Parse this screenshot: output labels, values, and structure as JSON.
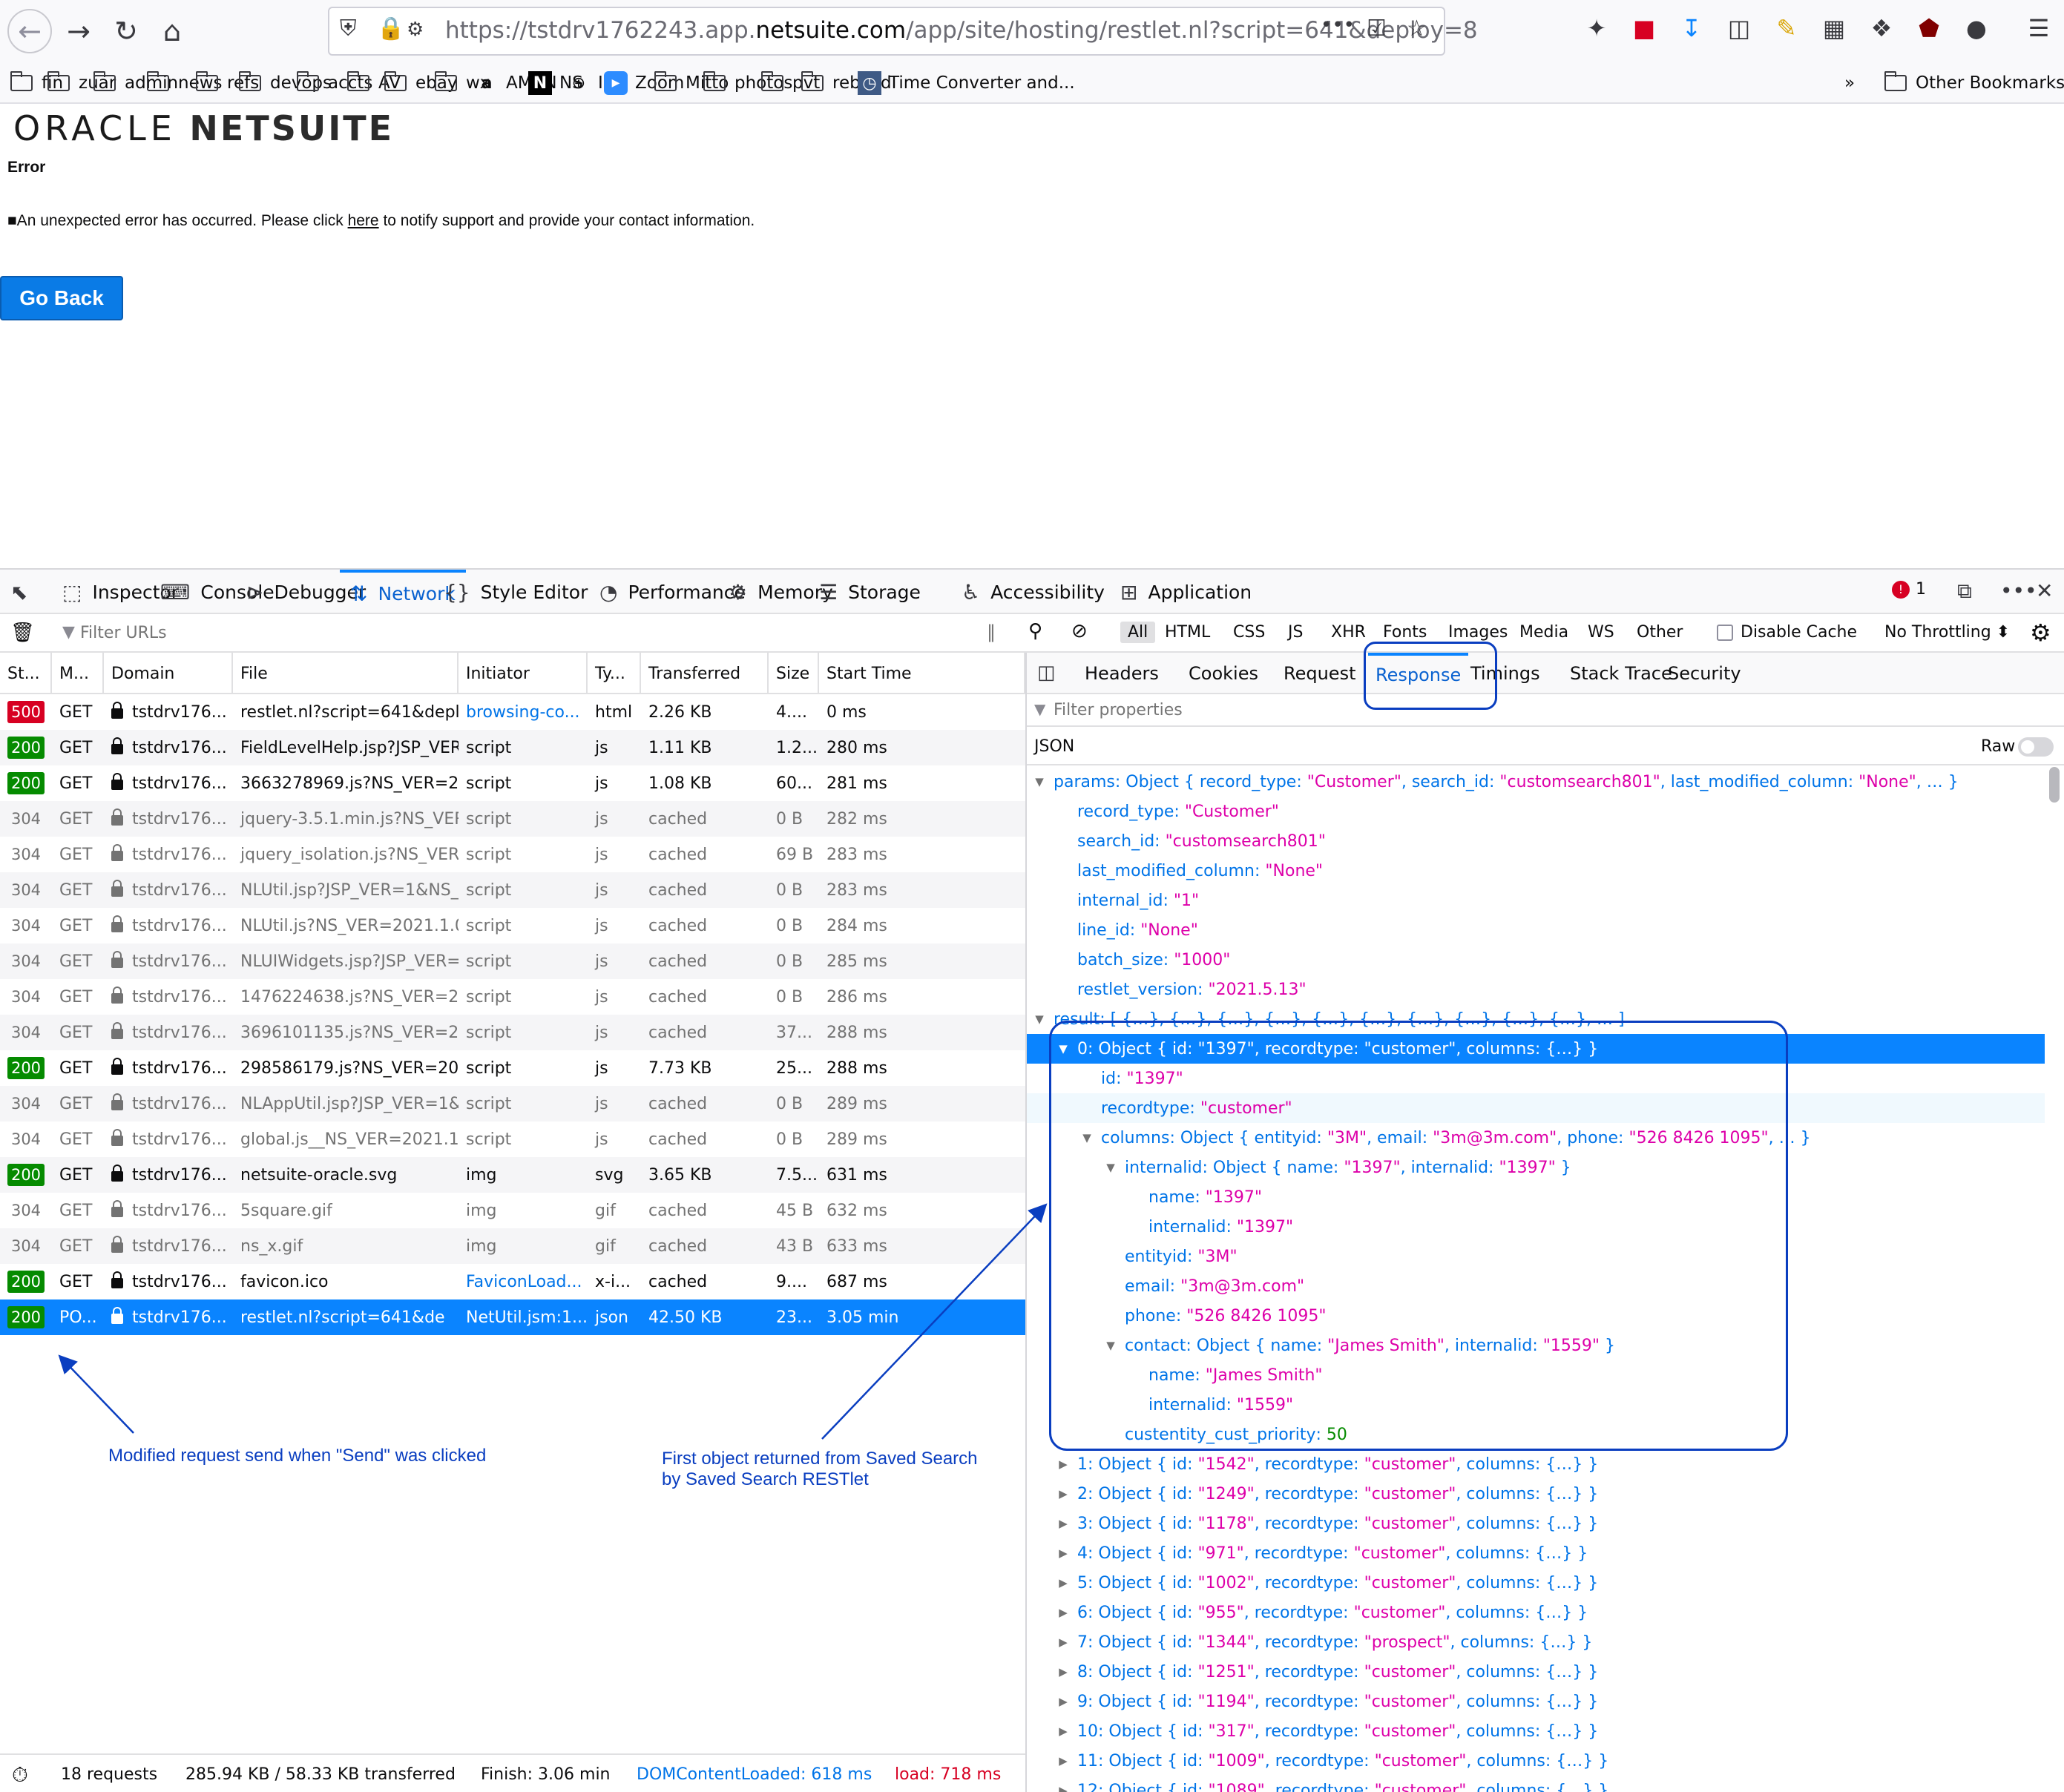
{
  "browser": {
    "url_prefix": "https://tstdrv1762243.app.",
    "url_domain": "netsuite.com",
    "url_suffix": "/app/site/hosting/restlet.nl?script=641&deploy=8",
    "more": "•••"
  },
  "bookmarks": [
    {
      "label": "fin",
      "icon": "folder-icon"
    },
    {
      "label": "zuar",
      "icon": "folder-icon"
    },
    {
      "label": "admin",
      "icon": "folder-icon"
    },
    {
      "label": "news",
      "icon": "folder-icon"
    },
    {
      "label": "refs",
      "icon": "folder-icon"
    },
    {
      "label": "devops",
      "icon": "folder-icon"
    },
    {
      "label": "accts",
      "icon": "folder-icon"
    },
    {
      "label": "AV",
      "icon": "folder-icon"
    },
    {
      "label": "ebay",
      "icon": "folder-icon"
    },
    {
      "label": "wx",
      "icon": "folder-icon"
    },
    {
      "label": "AMZN",
      "icon": "amazon-icon"
    },
    {
      "label": "NS",
      "icon": "netsuite-icon"
    },
    {
      "label": "IP",
      "icon": "globe-icon"
    },
    {
      "label": "Zoom",
      "icon": "zoom-icon"
    },
    {
      "label": "Mitto",
      "icon": "folder-icon"
    },
    {
      "label": "photos",
      "icon": "folder-icon"
    },
    {
      "label": "pvt",
      "icon": "folder-icon"
    },
    {
      "label": "rebuild",
      "icon": "folder-icon"
    },
    {
      "label": "Time Converter and...",
      "icon": "clock-icon"
    }
  ],
  "other_bookmarks": "Other Bookmarks",
  "page": {
    "logo_oracle": "ORACLE",
    "logo_netsuite": "NETSUITE",
    "error_title": "Error",
    "error_prefix": "■An unexpected error has occurred. Please click ",
    "error_link": "here",
    "error_suffix": " to notify support and provide your contact information.",
    "go_back": "Go Back"
  },
  "devtools": {
    "tabs": [
      "Inspector",
      "Console",
      "Debugger",
      "Network",
      "Style Editor",
      "Performance",
      "Memory",
      "Storage",
      "Accessibility",
      "Application"
    ],
    "selected_tab": "Network",
    "error_count": "1",
    "filter_placeholder": "Filter URLs",
    "type_filters": [
      "All",
      "HTML",
      "CSS",
      "JS",
      "XHR",
      "Fonts",
      "Images",
      "Media",
      "WS",
      "Other"
    ],
    "disable_cache": "Disable Cache",
    "throttling": "No Throttling ⬍",
    "columns": [
      "St...",
      "M...",
      "Domain",
      "File",
      "Initiator",
      "Ty...",
      "Transferred",
      "Size",
      "Start Time"
    ],
    "requests": [
      {
        "status": "500",
        "method": "GET",
        "domain": "tstdrv176...",
        "file": "restlet.nl?script=641&deploy",
        "initiator": "browsing-co...",
        "type": "html",
        "transferred": "2.26 KB",
        "size": "4....",
        "start": "0 ms"
      },
      {
        "status": "200",
        "method": "GET",
        "domain": "tstdrv176...",
        "file": "FieldLevelHelp.jsp?JSP_VER",
        "initiator": "script",
        "type": "js",
        "transferred": "1.11 KB",
        "size": "1.2...",
        "start": "280 ms"
      },
      {
        "status": "200",
        "method": "GET",
        "domain": "tstdrv176...",
        "file": "3663278969.js?NS_VER=20",
        "initiator": "script",
        "type": "js",
        "transferred": "1.08 KB",
        "size": "60...",
        "start": "281 ms"
      },
      {
        "status": "304",
        "method": "GET",
        "domain": "tstdrv176...",
        "file": "jquery-3.5.1.min.js?NS_VER=",
        "initiator": "script",
        "type": "js",
        "transferred": "cached",
        "size": "0 B",
        "start": "282 ms"
      },
      {
        "status": "304",
        "method": "GET",
        "domain": "tstdrv176...",
        "file": "jquery_isolation.js?NS_VER=",
        "initiator": "script",
        "type": "js",
        "transferred": "cached",
        "size": "69 B",
        "start": "283 ms"
      },
      {
        "status": "304",
        "method": "GET",
        "domain": "tstdrv176...",
        "file": "NLUtil.jsp?JSP_VER=1&NS_V",
        "initiator": "script",
        "type": "js",
        "transferred": "cached",
        "size": "0 B",
        "start": "283 ms"
      },
      {
        "status": "304",
        "method": "GET",
        "domain": "tstdrv176...",
        "file": "NLUtil.js?NS_VER=2021.1.08",
        "initiator": "script",
        "type": "js",
        "transferred": "cached",
        "size": "0 B",
        "start": "284 ms"
      },
      {
        "status": "304",
        "method": "GET",
        "domain": "tstdrv176...",
        "file": "NLUIWidgets.jsp?JSP_VER=1",
        "initiator": "script",
        "type": "js",
        "transferred": "cached",
        "size": "0 B",
        "start": "285 ms"
      },
      {
        "status": "304",
        "method": "GET",
        "domain": "tstdrv176...",
        "file": "1476224638.js?NS_VER=20",
        "initiator": "script",
        "type": "js",
        "transferred": "cached",
        "size": "0 B",
        "start": "286 ms"
      },
      {
        "status": "304",
        "method": "GET",
        "domain": "tstdrv176...",
        "file": "3696101135.js?NS_VER=202",
        "initiator": "script",
        "type": "js",
        "transferred": "cached",
        "size": "37...",
        "start": "288 ms"
      },
      {
        "status": "200",
        "method": "GET",
        "domain": "tstdrv176...",
        "file": "298586179.js?NS_VER=202",
        "initiator": "script",
        "type": "js",
        "transferred": "7.73 KB",
        "size": "25...",
        "start": "288 ms"
      },
      {
        "status": "304",
        "method": "GET",
        "domain": "tstdrv176...",
        "file": "NLAppUtil.jsp?JSP_VER=1&N",
        "initiator": "script",
        "type": "js",
        "transferred": "cached",
        "size": "0 B",
        "start": "289 ms"
      },
      {
        "status": "304",
        "method": "GET",
        "domain": "tstdrv176...",
        "file": "global.js__NS_VER=2021.1.0",
        "initiator": "script",
        "type": "js",
        "transferred": "cached",
        "size": "0 B",
        "start": "289 ms"
      },
      {
        "status": "200",
        "method": "GET",
        "domain": "tstdrv176...",
        "file": "netsuite-oracle.svg",
        "initiator": "img",
        "type": "svg",
        "transferred": "3.65 KB",
        "size": "7.5...",
        "start": "631 ms"
      },
      {
        "status": "304",
        "method": "GET",
        "domain": "tstdrv176...",
        "file": "5square.gif",
        "initiator": "img",
        "type": "gif",
        "transferred": "cached",
        "size": "45 B",
        "start": "632 ms"
      },
      {
        "status": "304",
        "method": "GET",
        "domain": "tstdrv176...",
        "file": "ns_x.gif",
        "initiator": "img",
        "type": "gif",
        "transferred": "cached",
        "size": "43 B",
        "start": "633 ms"
      },
      {
        "status": "200",
        "method": "GET",
        "domain": "tstdrv176...",
        "file": "favicon.ico",
        "initiator": "FaviconLoad...",
        "type": "x-i...",
        "transferred": "cached",
        "size": "9....",
        "start": "687 ms"
      },
      {
        "status": "200",
        "method": "PO...",
        "domain": "tstdrv176...",
        "file": "restlet.nl?script=641&de",
        "initiator": "NetUtil.jsm:1...",
        "type": "json",
        "transferred": "42.50 KB",
        "size": "23...",
        "start": "3.05 min"
      }
    ],
    "selected_request": 17,
    "summary": {
      "requests": "18 requests",
      "size": "285.94 KB / 58.33 KB transferred",
      "finish": "Finish: 3.06 min",
      "dom": "DOMContentLoaded: 618 ms",
      "load": "load: 718 ms"
    },
    "side_tabs": [
      "Headers",
      "Cookies",
      "Request",
      "Response",
      "Timings",
      "Stack Trace",
      "Security"
    ],
    "side_selected": "Response",
    "filter_properties": "Filter properties",
    "json_label": "JSON",
    "raw_label": "Raw",
    "json_lines": [
      {
        "indent": 0,
        "twisty": "open",
        "key": "params",
        "text": "Object { record_type: \"Customer\", search_id: \"customsearch801\", last_modified_column: \"None\", … }",
        "kind": "obj"
      },
      {
        "indent": 1,
        "twisty": "",
        "key": "record_type",
        "text": "\"Customer\"",
        "kind": "str"
      },
      {
        "indent": 1,
        "twisty": "",
        "key": "search_id",
        "text": "\"customsearch801\"",
        "kind": "str"
      },
      {
        "indent": 1,
        "twisty": "",
        "key": "last_modified_column",
        "text": "\"None\"",
        "kind": "str"
      },
      {
        "indent": 1,
        "twisty": "",
        "key": "internal_id",
        "text": "\"1\"",
        "kind": "str"
      },
      {
        "indent": 1,
        "twisty": "",
        "key": "line_id",
        "text": "\"None\"",
        "kind": "str"
      },
      {
        "indent": 1,
        "twisty": "",
        "key": "batch_size",
        "text": "\"1000\"",
        "kind": "str"
      },
      {
        "indent": 1,
        "twisty": "",
        "key": "restlet_version",
        "text": "\"2021.5.13\"",
        "kind": "str"
      },
      {
        "indent": 0,
        "twisty": "open",
        "key": "result",
        "text": "[ {…}, {…}, {…}, {…}, {…}, {…}, {…}, {…}, {…}, {…}, … ]",
        "kind": "obj"
      },
      {
        "indent": 1,
        "twisty": "open",
        "key": "0",
        "text": "Object { id: \"1397\", recordtype: \"customer\", columns: {…} }",
        "kind": "obj",
        "selected": true
      },
      {
        "indent": 2,
        "twisty": "",
        "key": "id",
        "text": "\"1397\"",
        "kind": "str"
      },
      {
        "indent": 2,
        "twisty": "",
        "key": "recordtype",
        "text": "\"customer\"",
        "kind": "str",
        "hover": true
      },
      {
        "indent": 2,
        "twisty": "open",
        "key": "columns",
        "text": "Object { entityid: \"3M\", email: \"3m@3m.com\", phone: \"526 8426 1095\", … }",
        "kind": "obj"
      },
      {
        "indent": 3,
        "twisty": "open",
        "key": "internalid",
        "text": "Object { name: \"1397\", internalid: \"1397\" }",
        "kind": "obj"
      },
      {
        "indent": 4,
        "twisty": "",
        "key": "name",
        "text": "\"1397\"",
        "kind": "str"
      },
      {
        "indent": 4,
        "twisty": "",
        "key": "internalid",
        "text": "\"1397\"",
        "kind": "str"
      },
      {
        "indent": 3,
        "twisty": "",
        "key": "entityid",
        "text": "\"3M\"",
        "kind": "str"
      },
      {
        "indent": 3,
        "twisty": "",
        "key": "email",
        "text": "\"3m@3m.com\"",
        "kind": "str"
      },
      {
        "indent": 3,
        "twisty": "",
        "key": "phone",
        "text": "\"526 8426 1095\"",
        "kind": "str"
      },
      {
        "indent": 3,
        "twisty": "open",
        "key": "contact",
        "text": "Object { name: \"James Smith\", internalid: \"1559\" }",
        "kind": "obj"
      },
      {
        "indent": 4,
        "twisty": "",
        "key": "name",
        "text": "\"James Smith\"",
        "kind": "str"
      },
      {
        "indent": 4,
        "twisty": "",
        "key": "internalid",
        "text": "\"1559\"",
        "kind": "str"
      },
      {
        "indent": 3,
        "twisty": "",
        "key": "custentity_cust_priority",
        "text": "50",
        "kind": "num"
      },
      {
        "indent": 1,
        "twisty": "closed",
        "key": "1",
        "text": "Object { id: \"1542\", recordtype: \"customer\", columns: {…} }",
        "kind": "obj"
      },
      {
        "indent": 1,
        "twisty": "closed",
        "key": "2",
        "text": "Object { id: \"1249\", recordtype: \"customer\", columns: {…} }",
        "kind": "obj"
      },
      {
        "indent": 1,
        "twisty": "closed",
        "key": "3",
        "text": "Object { id: \"1178\", recordtype: \"customer\", columns: {…} }",
        "kind": "obj"
      },
      {
        "indent": 1,
        "twisty": "closed",
        "key": "4",
        "text": "Object { id: \"971\", recordtype: \"customer\", columns: {…} }",
        "kind": "obj"
      },
      {
        "indent": 1,
        "twisty": "closed",
        "key": "5",
        "text": "Object { id: \"1002\", recordtype: \"customer\", columns: {…} }",
        "kind": "obj"
      },
      {
        "indent": 1,
        "twisty": "closed",
        "key": "6",
        "text": "Object { id: \"955\", recordtype: \"customer\", columns: {…} }",
        "kind": "obj"
      },
      {
        "indent": 1,
        "twisty": "closed",
        "key": "7",
        "text": "Object { id: \"1344\", recordtype: \"prospect\", columns: {…} }",
        "kind": "obj"
      },
      {
        "indent": 1,
        "twisty": "closed",
        "key": "8",
        "text": "Object { id: \"1251\", recordtype: \"customer\", columns: {…} }",
        "kind": "obj"
      },
      {
        "indent": 1,
        "twisty": "closed",
        "key": "9",
        "text": "Object { id: \"1194\", recordtype: \"customer\", columns: {…} }",
        "kind": "obj"
      },
      {
        "indent": 1,
        "twisty": "closed",
        "key": "10",
        "text": "Object { id: \"317\", recordtype: \"customer\", columns: {…} }",
        "kind": "obj"
      },
      {
        "indent": 1,
        "twisty": "closed",
        "key": "11",
        "text": "Object { id: \"1009\", recordtype: \"customer\", columns: {…} }",
        "kind": "obj"
      },
      {
        "indent": 1,
        "twisty": "closed",
        "key": "12",
        "text": "Object { id: \"1089\", recordtype: \"customer\", columns: {…} }",
        "kind": "obj"
      }
    ]
  },
  "annotations": {
    "left": "Modified request send when \"Send\" was clicked",
    "right_line1": "First object returned from Saved Search",
    "right_line2": "by Saved Search RESTlet"
  },
  "colors": {
    "accent": "#0a84ff",
    "status_ok": "#058b00",
    "status_err": "#d70022",
    "json_key": "#0074e8",
    "json_string": "#dd00a9",
    "annotation": "#0a3ec0"
  }
}
